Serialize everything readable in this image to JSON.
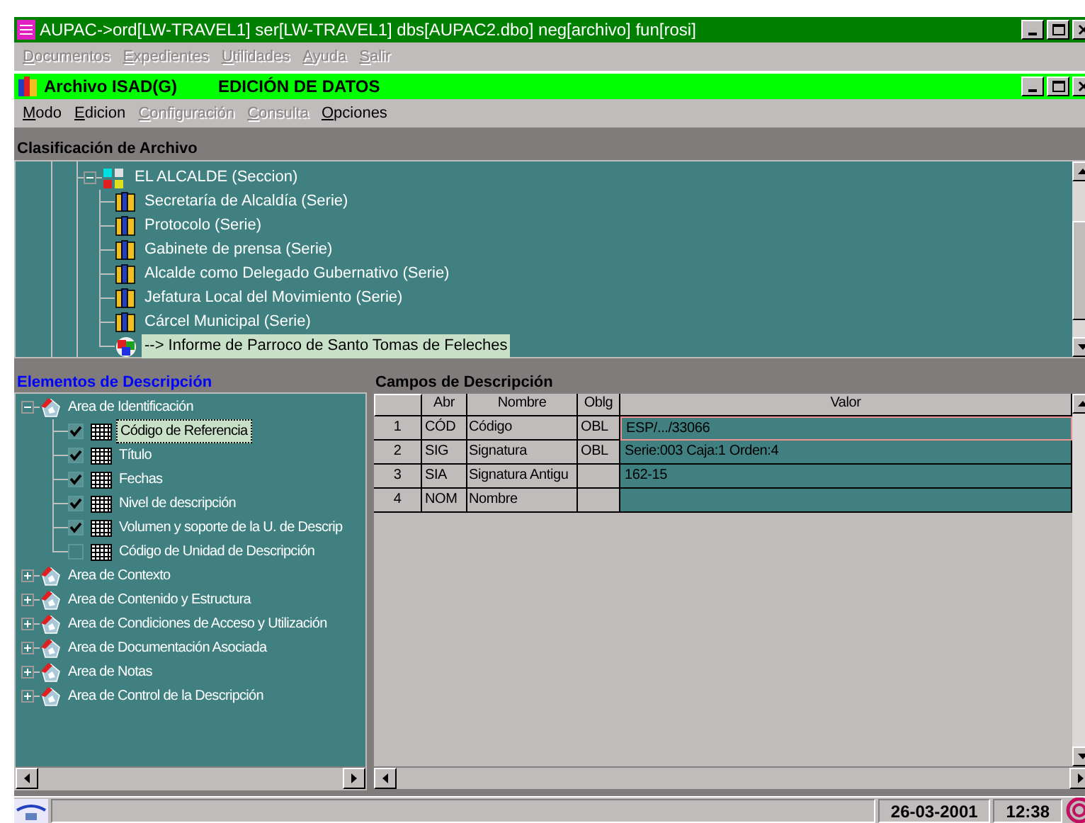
{
  "window": {
    "title": "AUPAC->ord[LW-TRAVEL1] ser[LW-TRAVEL1] dbs[AUPAC2.dbo] neg[archivo] fun[rosi]",
    "menu": [
      {
        "label": "Documentos",
        "disabled": true
      },
      {
        "label": "Expedientes",
        "disabled": true
      },
      {
        "label": "Utilidades",
        "disabled": true
      },
      {
        "label": "Ayuda",
        "disabled": true
      },
      {
        "label": "Salir",
        "disabled": true
      }
    ]
  },
  "child_window": {
    "title": "Archivo ISAD(G)",
    "subtitle": "EDICIÓN DE DATOS",
    "menu": [
      {
        "label": "Modo",
        "disabled": false
      },
      {
        "label": "Edicion",
        "disabled": false
      },
      {
        "label": "Configuración",
        "disabled": true
      },
      {
        "label": "Consulta",
        "disabled": true
      },
      {
        "label": "Opciones",
        "disabled": false
      }
    ]
  },
  "classification": {
    "label": "Clasificación de Archivo",
    "tree": [
      {
        "label": "EL ALCALDE  (Seccion)",
        "kind": "section",
        "expanded": true,
        "selected": false,
        "children": [
          {
            "label": "Secretaría de Alcaldía  (Serie)",
            "kind": "series",
            "selected": false
          },
          {
            "label": "Protocolo  (Serie)",
            "kind": "series",
            "selected": false
          },
          {
            "label": "Gabinete de prensa  (Serie)",
            "kind": "series",
            "selected": false
          },
          {
            "label": "Alcalde como Delegado Gubernativo  (Serie)",
            "kind": "series",
            "selected": false
          },
          {
            "label": "Jefatura Local del Movimiento  (Serie)",
            "kind": "series",
            "selected": false
          },
          {
            "label": "Cárcel Municipal  (Serie)",
            "kind": "series",
            "selected": false
          },
          {
            "label": "--> Informe de Parroco de Santo Tomas de Feleches",
            "kind": "document",
            "selected": true
          }
        ]
      }
    ]
  },
  "elements": {
    "label": "Elementos de Descripción",
    "tree": [
      {
        "label": "Area de Identificación",
        "expanded": true,
        "children": [
          {
            "label": "Código de Referencia",
            "checked": true,
            "selected": true
          },
          {
            "label": "Título",
            "checked": true,
            "selected": false
          },
          {
            "label": "Fechas",
            "checked": true,
            "selected": false
          },
          {
            "label": "Nivel de descripción",
            "checked": true,
            "selected": false
          },
          {
            "label": "Volumen y soporte de la U. de Descrip",
            "checked": true,
            "selected": false
          },
          {
            "label": "Código de Unidad de Descripción",
            "checked": false,
            "selected": false
          }
        ]
      },
      {
        "label": "Area de Contexto",
        "expanded": false
      },
      {
        "label": "Area de Contenido y Estructura",
        "expanded": false
      },
      {
        "label": "Area de Condiciones de Acceso y Utilización",
        "expanded": false
      },
      {
        "label": "Area de Documentación Asociada",
        "expanded": false
      },
      {
        "label": "Area de Notas",
        "expanded": false
      },
      {
        "label": "Area de Control de la Descripción",
        "expanded": false
      }
    ]
  },
  "fields": {
    "label": "Campos de Descripción",
    "columns": [
      "Abr",
      "Nombre",
      "Oblg",
      "Valor"
    ],
    "rows": [
      {
        "number": "1",
        "abr": "CÓD",
        "nombre": "Código",
        "oblg": "OBL",
        "valor": "ESP/.../33066",
        "selected": true
      },
      {
        "number": "2",
        "abr": "SIG",
        "nombre": "Signatura",
        "oblg": "OBL",
        "valor": "Serie:003 Caja:1 Orden:4",
        "selected": false
      },
      {
        "number": "3",
        "abr": "SIA",
        "nombre": "Signatura Antigu",
        "valor": "162-15",
        "selected": false
      },
      {
        "number": "4",
        "abr": "NOM",
        "nombre": "Nombre",
        "selected": false
      }
    ]
  },
  "status_bar": {
    "date": "26-03-2001",
    "time": "12:38"
  }
}
